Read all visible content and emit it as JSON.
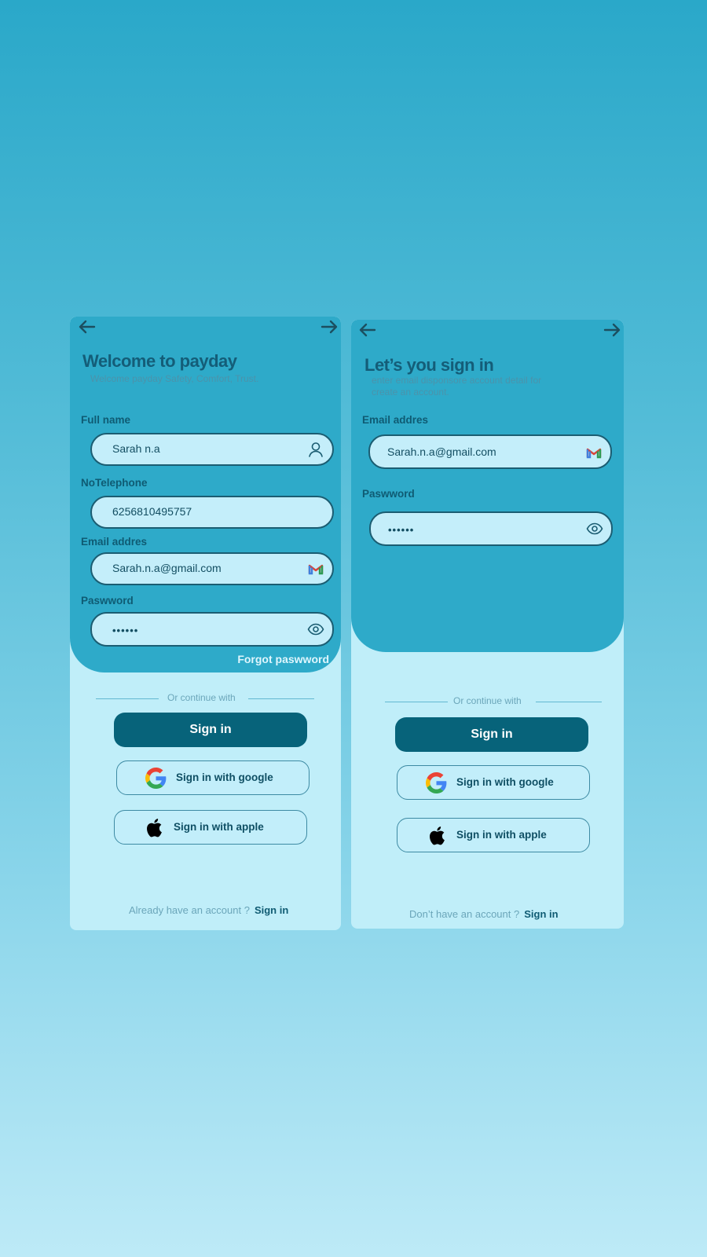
{
  "signup": {
    "title": "Welcome to payday",
    "subtitle": "Welcome payday Safety, Comfort, Trust.",
    "fields": {
      "fullname_label": "Full name",
      "fullname_value": "Sarah n.a",
      "phone_label": "NoTelephone",
      "phone_value": "6256810495757",
      "email_label": "Email addres",
      "email_value": "Sarah.n.a@gmail.com",
      "password_label": "Paswword",
      "password_value": "••••••"
    },
    "forgot": "Forgot paswword",
    "divider": "Or continue with",
    "signin_button": "Sign in",
    "google_button": "Sign in with google",
    "apple_button": "Sign in with apple",
    "footer_text": "Already have an account ?",
    "footer_link": "Sign in"
  },
  "signin": {
    "title": "Let’s you sign in",
    "subtitle_line1": "enter email disponsore account detail for",
    "subtitle_line2": "create an account.",
    "fields": {
      "email_label": "Email addres",
      "email_value": "Sarah.n.a@gmail.com",
      "password_label": "Paswword",
      "password_value": "••••••"
    },
    "divider": "Or continue with",
    "signin_button": "Sign in",
    "google_button": "Sign in with google",
    "apple_button": "Sign in with apple",
    "footer_text": "Don’t  have an account ?",
    "footer_link": "Sign in"
  },
  "icons": {
    "back": "arrow-left-icon",
    "forward": "arrow-right-icon",
    "user": "user-icon",
    "gmail": "gmail-icon",
    "eye": "eye-icon",
    "google": "google-icon",
    "apple": "apple-icon"
  },
  "colors": {
    "panel_top": "#2eaac9",
    "panel_bottom": "#c0eef9",
    "primary_button": "#07637a",
    "text_dark": "#0f5b73"
  }
}
